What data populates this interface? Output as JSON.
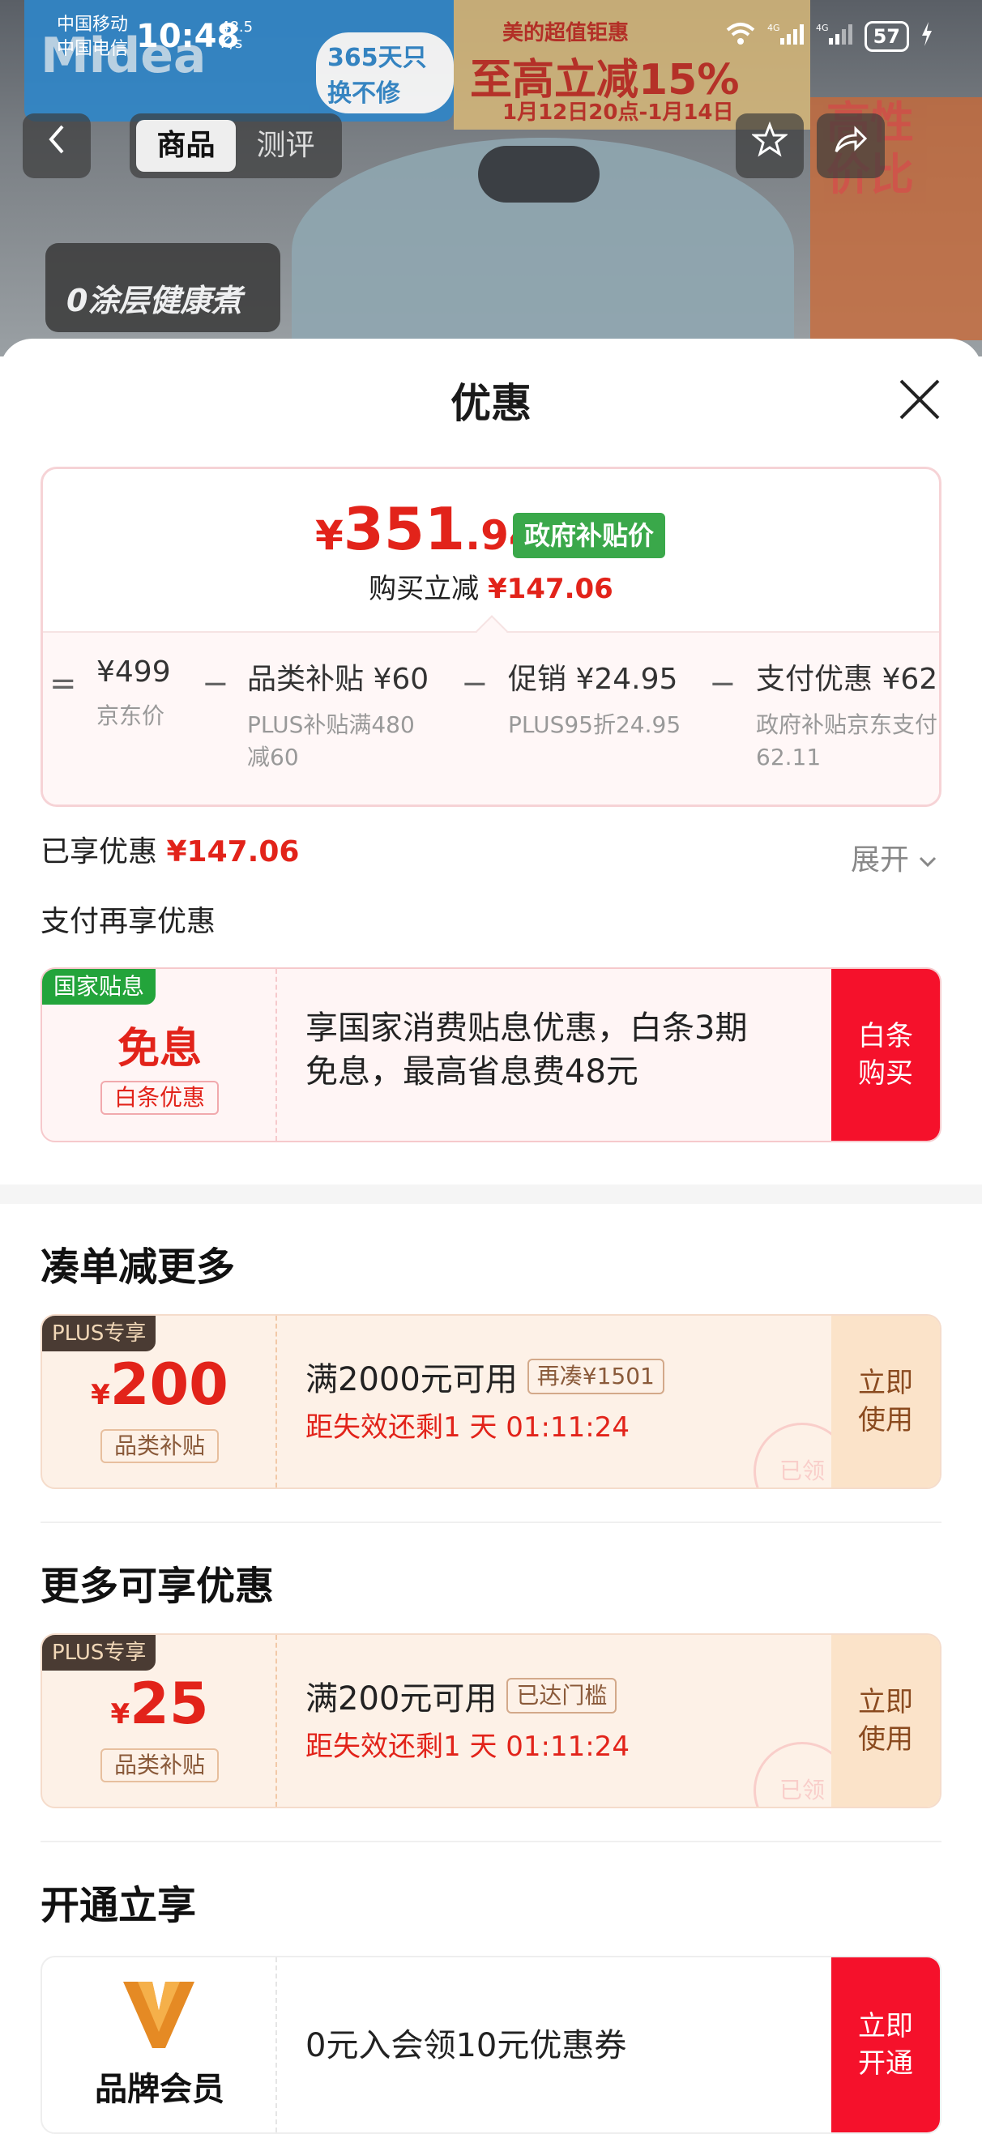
{
  "status_bar": {
    "carrier1": "中国移动",
    "carrier2": "中国电信",
    "time": "10:48",
    "speed_value": "48.5",
    "speed_unit": "K/s",
    "battery": "57"
  },
  "background_ad": {
    "brand": "Midea",
    "slogan": "0涂层健康煮",
    "promo_title": "美的超值钜惠",
    "promo_main": "至高立减15%",
    "promo_date": "1月12日20点-1月14日",
    "guarantee": "365天只换不修",
    "tag_right": "高性价比"
  },
  "nav": {
    "back_icon": "chevron-left-icon",
    "tabs": [
      "商品",
      "测评"
    ],
    "active_tab": 0
  },
  "sheet": {
    "title": "优惠",
    "price_card": {
      "currency": "¥",
      "price_int": "351",
      "price_dec": ".94",
      "gov_tag": "政府补贴价",
      "reduce_label": "购买立减",
      "reduce_value": "¥147.06",
      "breakdown": [
        {
          "op": "=",
          "label": "¥499",
          "sub": "京东价"
        },
        {
          "op": "−",
          "label": "品类补贴 ¥60",
          "sub": "PLUS补贴满480",
          "sub2": "减60"
        },
        {
          "op": "−",
          "label": "促销 ¥24.95",
          "sub": "PLUS95折24.95"
        },
        {
          "op": "−",
          "label": "支付优惠 ¥62",
          "sub": "政府补贴京东支付",
          "sub2": "62.11"
        }
      ]
    },
    "enjoyed_label": "已享优惠",
    "enjoyed_value": "¥147.06",
    "expand_label": "展开",
    "pay_more_label": "支付再享优惠",
    "baitiao": {
      "tag": "国家贴息",
      "big": "免息",
      "small": "白条优惠",
      "desc1": "享国家消费贴息优惠，白条3期",
      "desc2": "免息，最高省息费48元",
      "button1": "白条",
      "button2": "购买"
    },
    "section1": {
      "title": "凑单减更多",
      "coupon": {
        "tag": "PLUS专享",
        "currency": "¥",
        "amount": "200",
        "type": "品类补贴",
        "condition": "满2000元可用",
        "pill": "再凑¥1501",
        "countdown": "距失效还剩1 天 01:11:24",
        "button1": "立即",
        "button2": "使用",
        "stamp": "已领"
      }
    },
    "section2": {
      "title": "更多可享优惠",
      "coupon": {
        "tag": "PLUS专享",
        "currency": "¥",
        "amount": "25",
        "type": "品类补贴",
        "condition": "满200元可用",
        "pill": "已达门槛",
        "countdown": "距失效还剩1 天 01:11:24",
        "button1": "立即",
        "button2": "使用",
        "stamp": "已领"
      }
    },
    "section3": {
      "title": "开通立享",
      "member": {
        "brand_label": "品牌会员",
        "desc": "0元入会领10元优惠券",
        "button1": "立即",
        "button2": "开通"
      }
    }
  },
  "colors": {
    "accent_red": "#e2231a",
    "gov_green": "#3aa84a",
    "button_red": "#f5112b"
  }
}
